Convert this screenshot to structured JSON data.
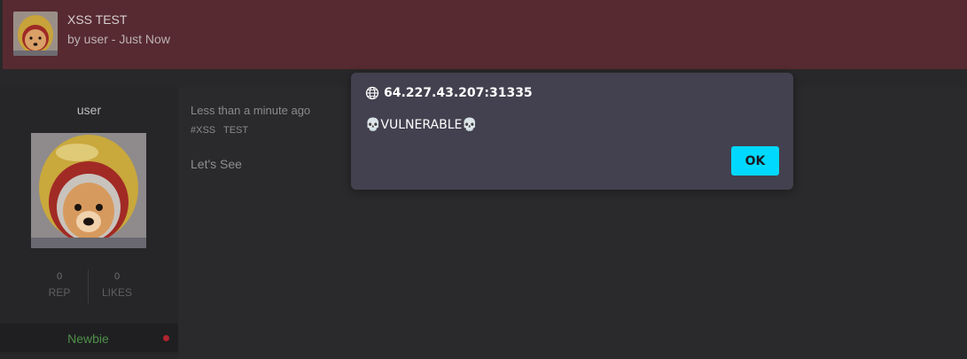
{
  "thread": {
    "title": "XSS TEST",
    "byline": "by user - Just Now"
  },
  "author": {
    "username": "user",
    "rep_count": "0",
    "rep_label": "REP",
    "likes_count": "0",
    "likes_label": "LIKES",
    "rank": "Newbie"
  },
  "post": {
    "timestamp": "Less than a minute ago",
    "tags": [
      "#XSS",
      "TEST"
    ],
    "content": "Let's See"
  },
  "alert": {
    "origin": "64.227.43.207:31335",
    "message": "💀VULNERABLE💀",
    "ok_label": "OK"
  },
  "icons": {
    "avatar": "astronaut-dog-avatar-icon",
    "globe": "globe-icon"
  },
  "colors": {
    "header_bg": "#572a31",
    "ok_button": "#00d9ff",
    "rank_text": "#4f8f48",
    "status_dot": "#b0242e"
  }
}
